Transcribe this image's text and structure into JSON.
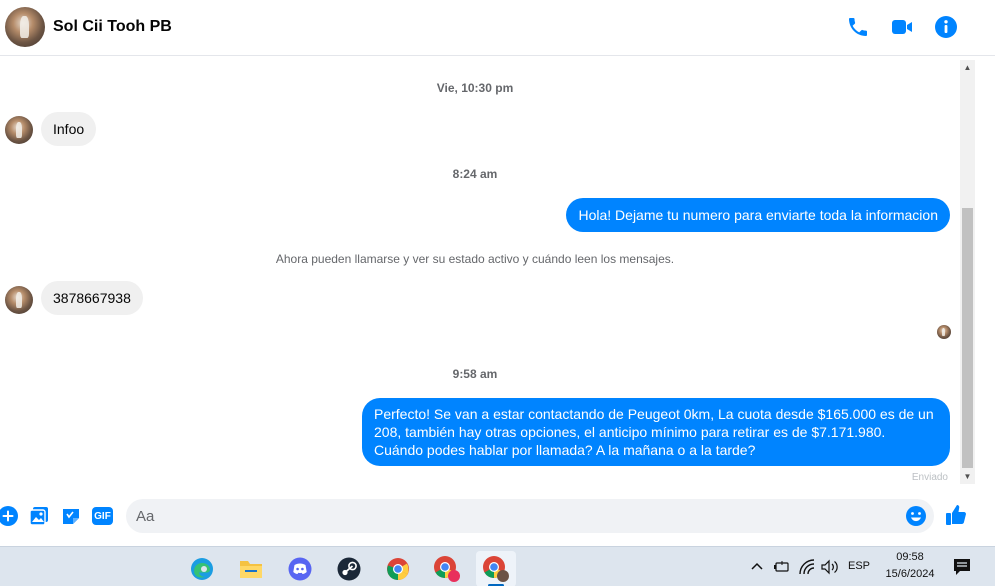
{
  "header": {
    "contact_name": "Sol Cii Tooh PB",
    "icons": [
      "phone-icon",
      "video-icon",
      "info-icon"
    ],
    "accent_color": "#0084ff"
  },
  "messages": {
    "ts1": "Vie, 10:30 pm",
    "in1": "Infoo",
    "ts2": "8:24 am",
    "out1": "Hola! Dejame tu numero para enviarte toda la informacion",
    "notice": "Ahora pueden llamarse y ver su estado activo y cuándo leen los mensajes.",
    "in2": "3878667938",
    "ts3": "9:58 am",
    "out2": "Perfecto!  Se van a estar contactando de Peugeot 0km, La cuota desde $165.000 es de un 208, también hay otras opciones, el anticipo mínimo para retirar es de $7.171.980. Cuándo podes hablar por llamada? A la mañana o a la tarde?",
    "status": "Enviado"
  },
  "composer": {
    "placeholder": "Aa",
    "gif_label": "GIF",
    "icons": [
      "plus-icon",
      "image-icon",
      "sticker-icon",
      "gif-icon",
      "emoji-icon",
      "like-icon"
    ]
  },
  "taskbar": {
    "apps": [
      "edge-icon",
      "file-explorer-icon",
      "discord-icon",
      "steam-icon",
      "chrome-icon",
      "chrome-profile-icon",
      "chrome-profile-active-icon"
    ],
    "language": "ESP",
    "time": "09:58",
    "date": "15/6/2024"
  }
}
